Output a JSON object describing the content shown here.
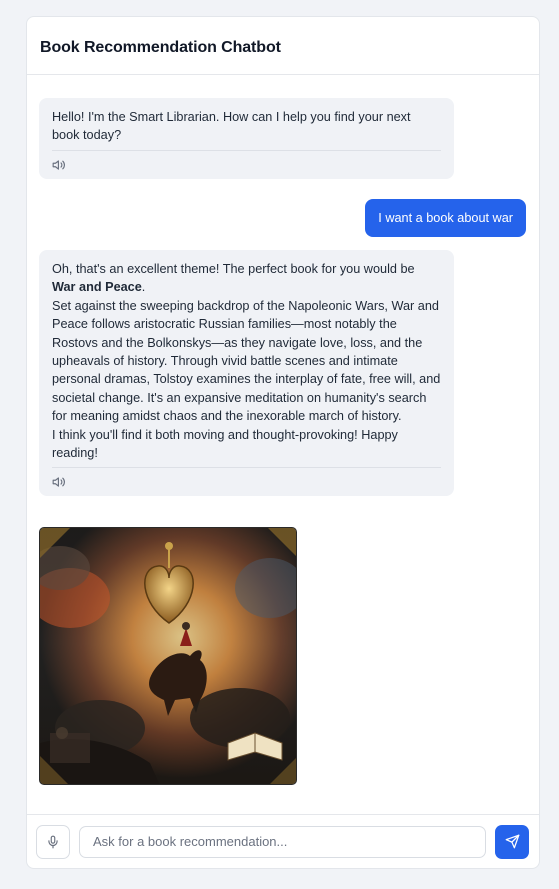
{
  "header": {
    "title": "Book Recommendation Chatbot"
  },
  "messages": {
    "greeting": {
      "text": "Hello! I'm the Smart Librarian. How can I help you find your next book today?"
    },
    "user": {
      "text": "I want a book about war"
    },
    "reply": {
      "intro": "Oh, that's an excellent theme! The perfect book for you would be ",
      "book_title": "War and Peace",
      "intro_end": ".",
      "summary": "Set against the sweeping backdrop of the Napoleonic Wars, War and Peace follows aristocratic Russian families—most notably the Rostovs and the Bolkonskys—as they navigate love, loss, and the upheavals of history. Through vivid battle scenes and intimate personal dramas, Tolstoy examines the interplay of fate, free will, and societal change. It's an expansive meditation on humanity's search for meaning amidst chaos and the inexorable march of history.",
      "closing": "I think you'll find it both moving and thought-provoking! Happy reading!"
    },
    "speaker_icon": "speaker-icon"
  },
  "image": {
    "icon": "book-cover-illustration"
  },
  "input": {
    "placeholder": "Ask for a book recommendation...",
    "value": ""
  },
  "icons": {
    "mic": "microphone-icon",
    "send": "send-icon"
  },
  "colors": {
    "accent": "#2563eb",
    "bubble": "#f0f2f6",
    "background": "#f1f3f7"
  }
}
